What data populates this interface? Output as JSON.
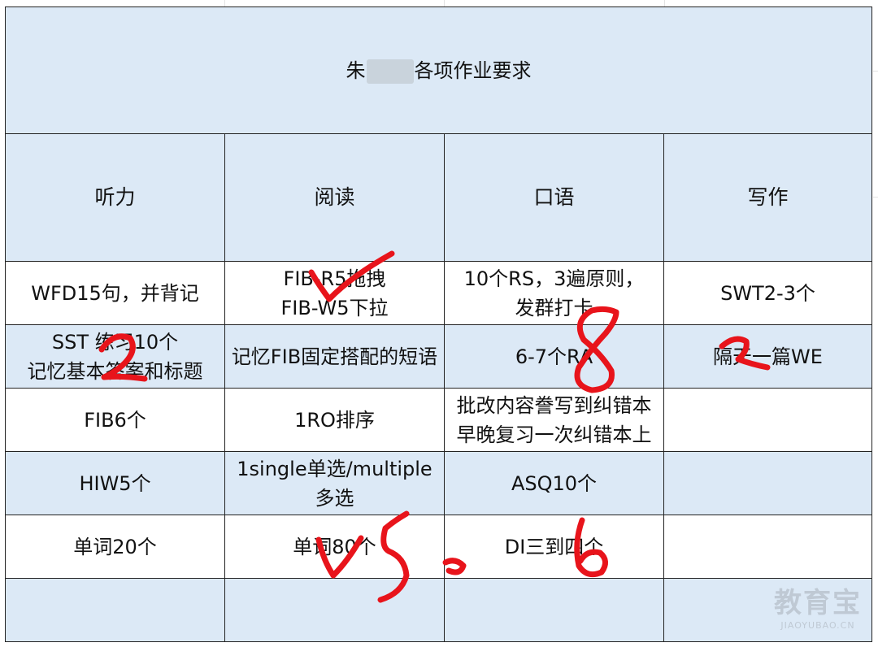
{
  "title": {
    "prefix": "朱",
    "suffix": "各项作业要求"
  },
  "headers": [
    "听力",
    "阅读",
    "口语",
    "写作"
  ],
  "rows": [
    {
      "listening": [
        "WFD15句，并背记"
      ],
      "reading": [
        "FIB-R5拖拽",
        "FIB-W5下拉"
      ],
      "speaking": [
        "10个RS，3遍原则，",
        "发群打卡"
      ],
      "writing": [
        "SWT2-3个"
      ]
    },
    {
      "listening": [
        "SST 练习10个",
        "记忆基本答案和标题"
      ],
      "reading": [
        "记忆FIB固定搭配的短语"
      ],
      "speaking": [
        "6-7个RA"
      ],
      "writing": [
        "隔天一篇WE"
      ]
    },
    {
      "listening": [
        "FIB6个"
      ],
      "reading": [
        "1RO排序"
      ],
      "speaking": [
        "批改内容誊写到纠错本",
        "早晚复习一次纠错本上"
      ],
      "writing": [
        ""
      ]
    },
    {
      "listening": [
        "HIW5个"
      ],
      "reading": [
        "1single单选/multiple",
        "多选"
      ],
      "speaking": [
        "ASQ10个"
      ],
      "writing": [
        ""
      ]
    },
    {
      "listening": [
        "单词20个"
      ],
      "reading": [
        "单词80个"
      ],
      "speaking": [
        "DI三到四个"
      ],
      "writing": [
        ""
      ]
    },
    {
      "listening": [
        ""
      ],
      "reading": [
        ""
      ],
      "speaking": [
        ""
      ],
      "writing": [
        ""
      ]
    }
  ],
  "watermark": {
    "logo": "教育宝",
    "url": "JIAOYUBAO.CN"
  },
  "colors": {
    "cell_blue": "#dce9f6",
    "red_text": "#e8141b",
    "ink": "#e8141b"
  }
}
